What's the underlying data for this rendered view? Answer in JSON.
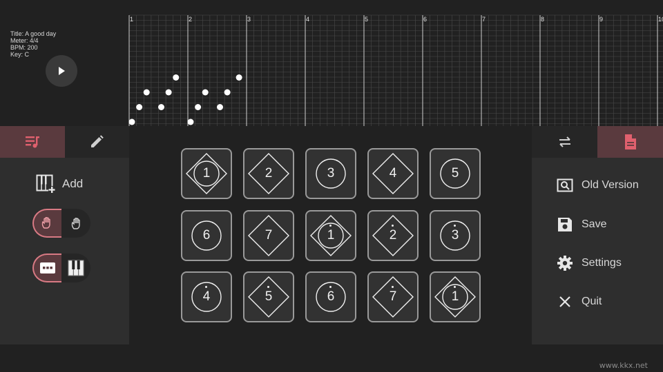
{
  "song": {
    "title_line": "Title: A good day",
    "meter_line": "Meter: 4/4",
    "bpm_line": "BPM: 200",
    "key_line": "Key: C"
  },
  "roll": {
    "measures": [
      "1",
      "2",
      "3",
      "4",
      "5",
      "6",
      "7",
      "8",
      "9",
      "10"
    ],
    "notes": [
      {
        "beat": 0.0,
        "pitch": 0
      },
      {
        "beat": 0.5,
        "pitch": 1
      },
      {
        "beat": 1.0,
        "pitch": 2
      },
      {
        "beat": 2.0,
        "pitch": 1
      },
      {
        "beat": 2.5,
        "pitch": 2
      },
      {
        "beat": 3.0,
        "pitch": 3
      },
      {
        "beat": 4.0,
        "pitch": 0
      },
      {
        "beat": 4.5,
        "pitch": 1
      },
      {
        "beat": 5.0,
        "pitch": 2
      },
      {
        "beat": 6.0,
        "pitch": 1
      },
      {
        "beat": 6.5,
        "pitch": 2
      },
      {
        "beat": 7.3,
        "pitch": 3
      }
    ]
  },
  "left_panel": {
    "tabs": [
      {
        "icon": "playlist-music-icon",
        "active": true
      },
      {
        "icon": "pencil-icon",
        "active": false
      }
    ],
    "add_label": "Add"
  },
  "right_panel": {
    "tabs": [
      {
        "icon": "swap-icon",
        "active": false
      },
      {
        "icon": "file-icon",
        "active": true
      }
    ],
    "menu": [
      {
        "label": "Old Version",
        "icon": "search-file-icon"
      },
      {
        "label": "Save",
        "icon": "save-icon"
      },
      {
        "label": "Settings",
        "icon": "gear-icon"
      },
      {
        "label": "Quit",
        "icon": "close-icon"
      }
    ]
  },
  "pads": [
    {
      "label": "1",
      "dot": "none",
      "shape": "both"
    },
    {
      "label": "2",
      "dot": "none",
      "shape": "diamond"
    },
    {
      "label": "3",
      "dot": "none",
      "shape": "circle"
    },
    {
      "label": "4",
      "dot": "none",
      "shape": "diamond"
    },
    {
      "label": "5",
      "dot": "none",
      "shape": "circle"
    },
    {
      "label": "6",
      "dot": "none",
      "shape": "circle"
    },
    {
      "label": "7",
      "dot": "none",
      "shape": "diamond"
    },
    {
      "label": "1",
      "dot": "above",
      "shape": "both"
    },
    {
      "label": "2",
      "dot": "above",
      "shape": "diamond"
    },
    {
      "label": "3",
      "dot": "above",
      "shape": "circle"
    },
    {
      "label": "4",
      "dot": "above",
      "shape": "circle"
    },
    {
      "label": "5",
      "dot": "above",
      "shape": "diamond"
    },
    {
      "label": "6",
      "dot": "above",
      "shape": "circle"
    },
    {
      "label": "7",
      "dot": "above",
      "shape": "diamond"
    },
    {
      "label": "1",
      "dot": "above",
      "shape": "both"
    }
  ],
  "watermark": "www.kkx.net",
  "colors": {
    "accent": "#e0606e",
    "accent_bg": "#5a3a3e"
  }
}
